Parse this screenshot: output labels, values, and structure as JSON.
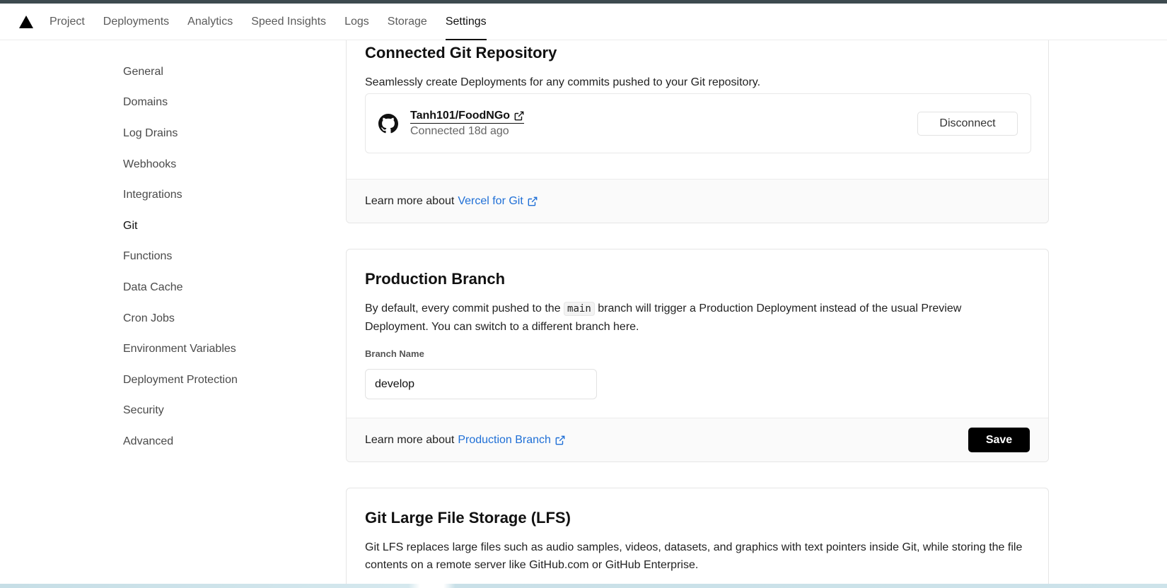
{
  "topnav": {
    "logo_icon": "vercel-triangle-icon",
    "tabs": [
      {
        "label": "Project"
      },
      {
        "label": "Deployments"
      },
      {
        "label": "Analytics"
      },
      {
        "label": "Speed Insights"
      },
      {
        "label": "Logs"
      },
      {
        "label": "Storage"
      },
      {
        "label": "Settings",
        "active": true
      }
    ]
  },
  "sidebar": {
    "items": [
      {
        "label": "General"
      },
      {
        "label": "Domains"
      },
      {
        "label": "Log Drains"
      },
      {
        "label": "Webhooks"
      },
      {
        "label": "Integrations"
      },
      {
        "label": "Git",
        "active": true
      },
      {
        "label": "Functions"
      },
      {
        "label": "Data Cache"
      },
      {
        "label": "Cron Jobs"
      },
      {
        "label": "Environment Variables"
      },
      {
        "label": "Deployment Protection"
      },
      {
        "label": "Security"
      },
      {
        "label": "Advanced"
      }
    ]
  },
  "git_repo": {
    "title": "Connected Git Repository",
    "description": "Seamlessly create Deployments for any commits pushed to your Git repository.",
    "repo_name": "Tanh101/FoodNGo",
    "status": "Connected 18d ago",
    "disconnect_label": "Disconnect",
    "footer_prefix": "Learn more about",
    "footer_link": "Vercel for Git"
  },
  "production_branch": {
    "title": "Production Branch",
    "desc_before": "By default, every commit pushed to the",
    "desc_code": "main",
    "desc_after": "branch will trigger a Production Deployment instead of the usual Preview Deployment. You can switch to a different branch here.",
    "field_label": "Branch Name",
    "field_value": "develop",
    "footer_prefix": "Learn more about",
    "footer_link": "Production Branch",
    "save_label": "Save"
  },
  "lfs": {
    "title": "Git Large File Storage (LFS)",
    "description": "Git LFS replaces large files such as audio samples, videos, datasets, and graphics with text pointers inside Git, while storing the file contents on a remote server like GitHub.com or GitHub Enterprise."
  },
  "colors": {
    "accent_link": "#1f6fd6",
    "primary_button": "#000000",
    "top_strip": "#3d4a4f"
  }
}
